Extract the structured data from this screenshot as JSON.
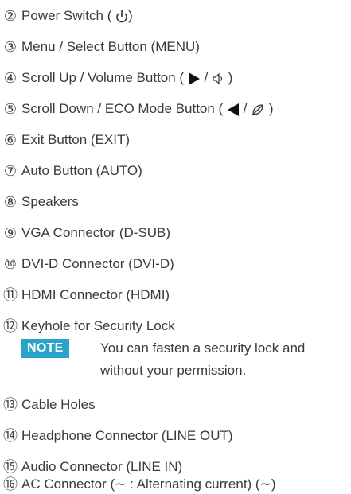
{
  "items": [
    {
      "num": "②",
      "pre": "Power Switch ( ",
      "icon": "power-icon",
      "post": ")"
    },
    {
      "num": "③",
      "text": "Menu / Select Button (MENU)"
    },
    {
      "num": "④",
      "pre": "Scroll Up / Volume Button ( ",
      "sep": " / ",
      "post": " )",
      "icon": "triangle-right-icon",
      "icon2": "speaker-icon"
    },
    {
      "num": "⑤",
      "pre": "Scroll Down / ECO Mode Button ( ",
      "sep": " / ",
      "post": " )",
      "icon": "triangle-left-icon",
      "icon2": "eco-leaf-icon"
    },
    {
      "num": "⑥",
      "text": "Exit Button (EXIT)"
    },
    {
      "num": "⑦",
      "text": "Auto Button (AUTO)"
    },
    {
      "num": "⑧",
      "text": "Speakers"
    },
    {
      "num": "⑨",
      "text": "VGA Connector (D-SUB)"
    },
    {
      "num": "⑩",
      "text": "DVI-D Connector (DVI-D)"
    },
    {
      "num": "⑪",
      "text": "HDMI Connector (HDMI)"
    },
    {
      "num": "⑫",
      "text": "Keyhole for Security Lock"
    },
    {
      "num": "⑬",
      "text": "Cable Holes"
    },
    {
      "num": "⑭",
      "text": "Headphone Connector (LINE OUT)"
    },
    {
      "num": "⑮",
      "text": "Audio Connector (LINE IN)"
    },
    {
      "num": "⑯",
      "text": "AC Connector (∼ : Alternating current) (∼)"
    }
  ],
  "note": {
    "label": "NOTE",
    "line1": "You can fasten a security lock and",
    "line2": "without your permission."
  },
  "colors": {
    "note_badge": "#29a4c9",
    "text": "#3a3a3a"
  }
}
